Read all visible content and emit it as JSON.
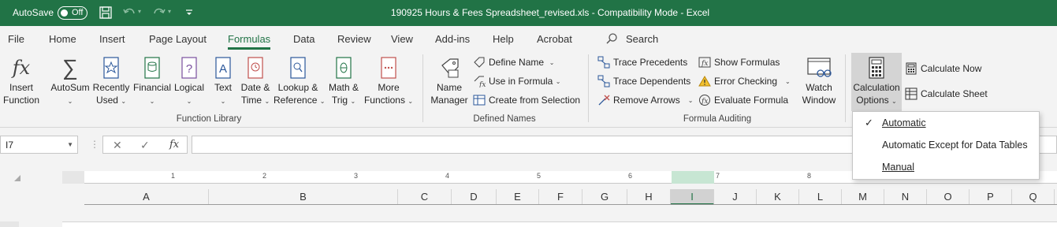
{
  "titlebar": {
    "autosave_label": "AutoSave",
    "autosave_state": "Off",
    "title": "190925 Hours & Fees Spreadsheet_revised.xls  -  Compatibility Mode  -  Excel",
    "bg_color": "#217346"
  },
  "tabs": [
    "File",
    "Home",
    "Insert",
    "Page Layout",
    "Formulas",
    "Data",
    "Review",
    "View",
    "Add-ins",
    "Help",
    "Acrobat"
  ],
  "active_tab": "Formulas",
  "search_label": "Search",
  "function_library": {
    "label": "Function Library",
    "insert_function": [
      "Insert",
      "Function"
    ],
    "autosum": "AutoSum",
    "recently_used": [
      "Recently",
      "Used"
    ],
    "financial": "Financial",
    "logical": "Logical",
    "text": "Text",
    "date_time": [
      "Date &",
      "Time"
    ],
    "lookup_reference": [
      "Lookup &",
      "Reference"
    ],
    "math_trig": [
      "Math &",
      "Trig"
    ],
    "more_functions": [
      "More",
      "Functions"
    ]
  },
  "defined_names": {
    "label": "Defined Names",
    "name_manager": [
      "Name",
      "Manager"
    ],
    "define_name": "Define Name",
    "use_in_formula": "Use in Formula",
    "create_from_selection": "Create from Selection"
  },
  "formula_auditing": {
    "label": "Formula Auditing",
    "trace_precedents": "Trace Precedents",
    "trace_dependents": "Trace Dependents",
    "remove_arrows": "Remove Arrows",
    "show_formulas": "Show Formulas",
    "error_checking": "Error Checking",
    "evaluate_formula": "Evaluate Formula",
    "watch_window": [
      "Watch",
      "Window"
    ]
  },
  "calculation": {
    "calc_options": [
      "Calculation",
      "Options"
    ],
    "calculate_now": "Calculate Now",
    "calculate_sheet": "Calculate Sheet"
  },
  "formula_bar": {
    "name_box": "I7",
    "cancel": "✕",
    "enter": "✓",
    "fx": "fx",
    "value": ""
  },
  "ruler_numbers": [
    "1",
    "2",
    "3",
    "4",
    "5",
    "6",
    "7",
    "8"
  ],
  "columns": [
    "A",
    "B",
    "C",
    "D",
    "E",
    "F",
    "G",
    "H",
    "I",
    "J",
    "K",
    "L",
    "M",
    "N",
    "O",
    "P",
    "Q"
  ],
  "selected_column": "I",
  "calc_menu": {
    "items": [
      {
        "label": "Automatic",
        "checked": true
      },
      {
        "label": "Automatic Except for Data Tables",
        "checked": false
      },
      {
        "label": "Manual",
        "checked": false
      }
    ]
  }
}
